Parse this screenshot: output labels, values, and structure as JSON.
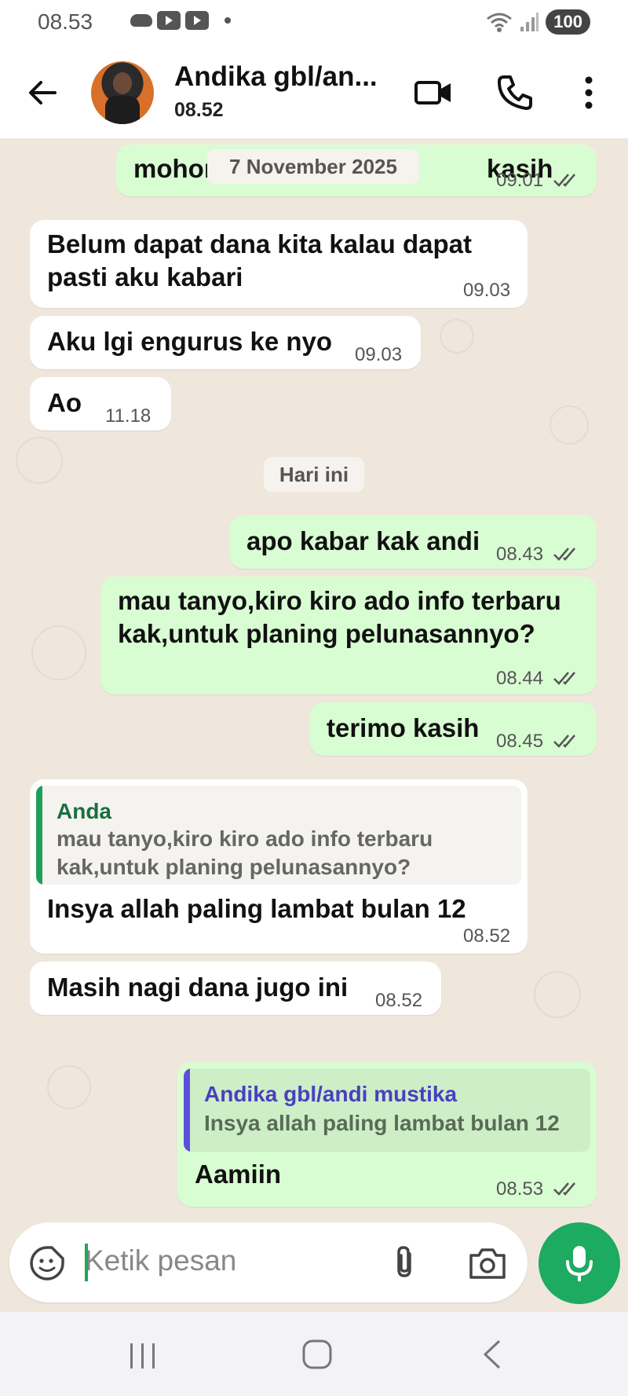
{
  "status_bar": {
    "time": "08.53",
    "battery": "100",
    "icons": [
      "cloud-icon",
      "youtube-icon",
      "youtube-icon",
      "dot-icon",
      "wifi-icon",
      "signal-icon"
    ]
  },
  "header": {
    "name": "Andika gbl/an...",
    "status": "08.52",
    "icons": [
      "back-arrow-icon",
      "video-call-icon",
      "phone-icon",
      "more-vert-icon"
    ]
  },
  "chat": {
    "date_chip_1": "7 November 2025",
    "date_chip_2": "Hari ini",
    "messages": [
      {
        "dir": "out",
        "text": "mohon",
        "text_end": "kasih",
        "time": "09.01"
      },
      {
        "dir": "in",
        "line1": "Belum dapat dana kita kalau dapat",
        "line2": "pasti aku kabari",
        "time": "09.03"
      },
      {
        "dir": "in",
        "text": "Aku lgi engurus ke nyo",
        "time": "09.03"
      },
      {
        "dir": "in",
        "text": "Ao",
        "time": "11.18"
      },
      {
        "dir": "out",
        "text": "apo kabar kak andi",
        "time": "08.43"
      },
      {
        "dir": "out",
        "line1": "mau tanyo,kiro kiro ado info terbaru",
        "line2": "kak,untuk planing pelunasannyo?",
        "time": "08.44"
      },
      {
        "dir": "out",
        "text": "terimo kasih",
        "time": "08.45"
      },
      {
        "dir": "in",
        "quote_name": "Anda",
        "quote_line1": "mau tanyo,kiro kiro ado info terbaru",
        "quote_line2": "kak,untuk planing pelunasannyo?",
        "text": "Insya allah paling lambat bulan 12",
        "time": "08.52"
      },
      {
        "dir": "in",
        "text": "Masih nagi dana jugo ini",
        "time": "08.52"
      },
      {
        "dir": "out",
        "quote_name": "Andika gbl/andi mustika",
        "quote_text": "Insya allah paling lambat bulan 12",
        "text": "Aamiin",
        "time": "08.53"
      }
    ]
  },
  "input": {
    "placeholder": "Ketik pesan",
    "icons": [
      "sticker-icon",
      "attach-icon",
      "camera-icon",
      "mic-icon"
    ]
  },
  "colors": {
    "accent": "#1daa61",
    "outgoing_bubble": "#d9fdd3",
    "incoming_bubble": "#ffffff",
    "chat_background": "#efe7dc",
    "quote_in_bar": "#1f9e5a",
    "quote_out_bar": "#5b4fdc"
  }
}
